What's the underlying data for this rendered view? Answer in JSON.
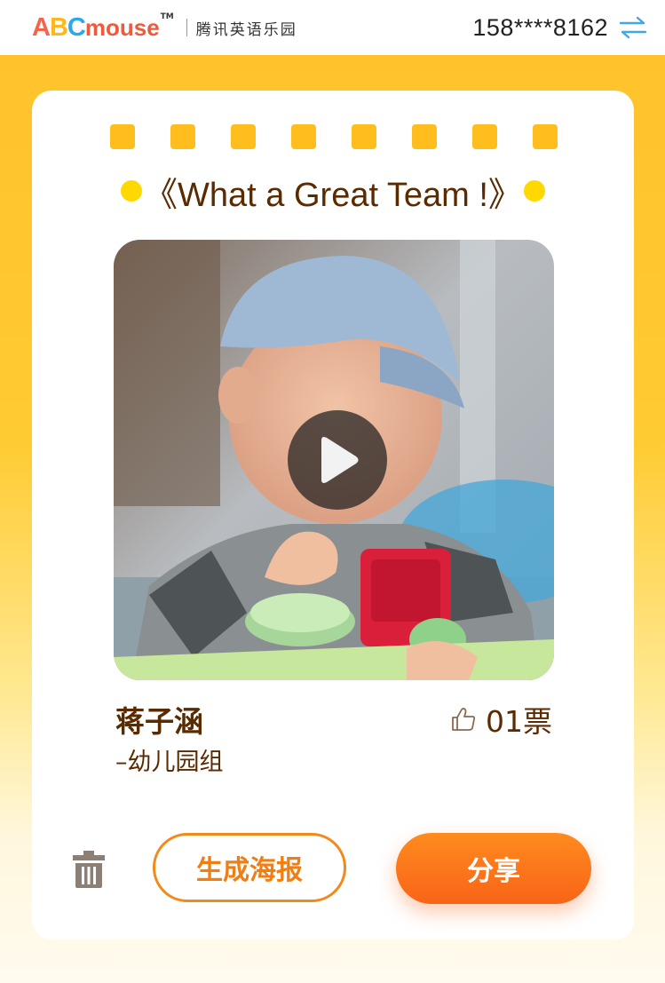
{
  "header": {
    "logo_letters": [
      "A",
      "B",
      "C"
    ],
    "logo_word": "mouse",
    "logo_tm": "TM",
    "logo_subtitle": "腾讯英语乐园",
    "account_phone": "158****8162",
    "switch_icon": "swap-arrows-icon"
  },
  "card": {
    "title": "《What a Great Team !》",
    "video": {
      "play_icon": "play-icon"
    },
    "student_name": "蒋子涵",
    "student_group": "–幼儿园组",
    "votes": "01票",
    "vote_icon": "thumbs-up-icon"
  },
  "actions": {
    "delete_icon": "trash-icon",
    "poster_label": "生成海报",
    "share_label": "分享"
  },
  "colors": {
    "brand_yellow": "#FFC12B",
    "title_brown": "#5A2A00",
    "accent_orange": "#F86418",
    "logo_a": "#F7644A",
    "logo_b": "#FFB81C",
    "logo_c": "#2BA9E8",
    "logo_word": "#F05A3C"
  }
}
